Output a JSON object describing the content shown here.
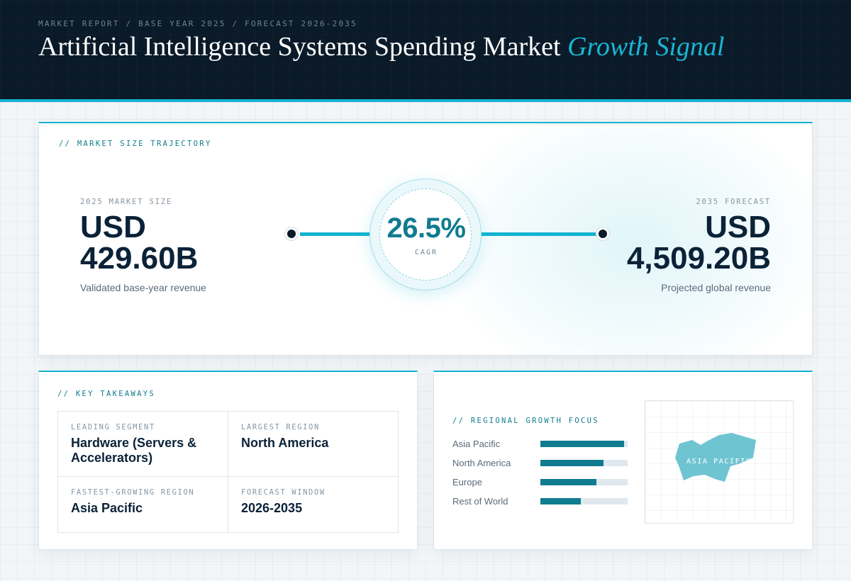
{
  "header": {
    "eyebrow": "MARKET REPORT / BASE YEAR 2025 / FORECAST 2026-2035",
    "title_main": "Artificial Intelligence Systems Spending Market ",
    "title_accent": "Growth Signal"
  },
  "trajectory": {
    "label": "// MARKET SIZE TRAJECTORY",
    "base": {
      "label": "2025 MARKET SIZE",
      "currency": "USD",
      "value": "429.60B",
      "caption": "Validated base-year revenue"
    },
    "forecast": {
      "label": "2035 FORECAST",
      "currency": "USD",
      "value": "4,509.20B",
      "caption": "Projected global revenue"
    },
    "cagr": {
      "value": "26.5%",
      "caption": "CAGR"
    }
  },
  "takeaways": {
    "label": "// KEY TAKEAWAYS",
    "items": [
      {
        "label": "LEADING SEGMENT",
        "value": "Hardware (Servers & Accelerators)"
      },
      {
        "label": "LARGEST REGION",
        "value": "North America"
      },
      {
        "label": "FASTEST-GROWING REGION",
        "value": "Asia Pacific"
      },
      {
        "label": "FORECAST WINDOW",
        "value": "2026-2035"
      }
    ]
  },
  "regional": {
    "label": "// REGIONAL GROWTH FOCUS",
    "map_label": "ASIA PACIFIC",
    "regions": [
      {
        "name": "Asia Pacific",
        "level": 0.96
      },
      {
        "name": "North America",
        "level": 0.72
      },
      {
        "name": "Europe",
        "level": 0.64
      },
      {
        "name": "Rest of World",
        "level": 0.46
      }
    ]
  },
  "colors": {
    "accent": "#12b3d0",
    "teal": "#0f7c8f",
    "navy": "#0b1a28",
    "map_fill": "#6fc4d2"
  }
}
